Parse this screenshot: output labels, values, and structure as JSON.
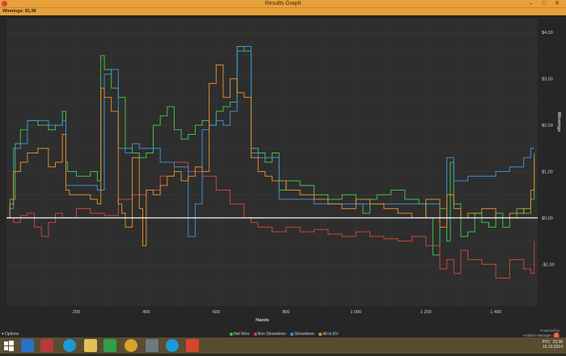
{
  "window": {
    "title": "Results Graph",
    "minimize": "–",
    "maximize": "□",
    "close": "✕",
    "app_icon": "holdem-manager-icon"
  },
  "winnings_label": "Winnings: $1,96",
  "footer": {
    "options_label": "Options",
    "legend": [
      {
        "label": "Net Won",
        "color": "#3fc24a"
      },
      {
        "label": "Non Showdown",
        "color": "#c9463a"
      },
      {
        "label": "Showdown",
        "color": "#3d8fd6"
      },
      {
        "label": "All-In EV",
        "color": "#e08a2c"
      }
    ],
    "powered_by": "Powered by",
    "brand": "HoldEm Manager",
    "brand_num": "2"
  },
  "taskbar": {
    "icons": [
      "windows-start-icon",
      "ie-icon",
      "save-icon",
      "skype-icon",
      "explorer-icon",
      "store-icon",
      "chrome-icon",
      "media-icon",
      "skype2-icon",
      "hm2-icon"
    ],
    "lang": "РУС",
    "time": "23:30",
    "date": "16.10.2014"
  },
  "chart_data": {
    "type": "line",
    "xlabel": "Hands",
    "ylabel": "Winnings",
    "x_ticks": [
      "200",
      "400",
      "600",
      "800",
      "1 000",
      "1 200",
      "1 400"
    ],
    "y_ticks": [
      "$4,00",
      "$3,00",
      "$2,00",
      "$1,00",
      "$0,00",
      "-$1,00"
    ],
    "xlim": [
      0,
      1520
    ],
    "ylim": [
      -1.9,
      4.3
    ],
    "grid": true,
    "series": [
      {
        "name": "Net Won",
        "color": "#3fc24a",
        "x": [
          0,
          10,
          25,
          40,
          60,
          90,
          120,
          140,
          160,
          170,
          175,
          200,
          240,
          260,
          270,
          280,
          300,
          320,
          340,
          360,
          380,
          400,
          420,
          440,
          460,
          480,
          500,
          520,
          540,
          560,
          580,
          600,
          620,
          640,
          660,
          680,
          700,
          720,
          740,
          760,
          780,
          800,
          840,
          880,
          920,
          960,
          1000,
          1020,
          1040,
          1060,
          1100,
          1140,
          1180,
          1200,
          1220,
          1240,
          1260,
          1270,
          1280,
          1300,
          1320,
          1340,
          1360,
          1380,
          1400,
          1420,
          1440,
          1460,
          1480,
          1500,
          1510
        ],
        "y": [
          0,
          0.4,
          1.6,
          1.9,
          2.1,
          2.0,
          1.9,
          2.0,
          2.3,
          1.2,
          1.0,
          0.9,
          1.0,
          0.8,
          3.5,
          3.2,
          2.8,
          2.6,
          1.5,
          1.4,
          1.3,
          1.4,
          2.0,
          2.2,
          2.4,
          1.9,
          1.7,
          1.8,
          2.0,
          2.1,
          2.0,
          2.3,
          2.4,
          2.5,
          3.7,
          3.6,
          1.5,
          1.4,
          1.2,
          1.4,
          0.6,
          0.8,
          0.7,
          0.5,
          0.4,
          0.5,
          0.3,
          0.1,
          0.4,
          0.5,
          0.6,
          0.4,
          0.3,
          0.0,
          -0.8,
          0.2,
          -0.5,
          1.2,
          0.3,
          -0.4,
          -0.3,
          0.1,
          -0.1,
          -0.2,
          0.1,
          -0.2,
          0.0,
          0.2,
          0.1,
          0.4,
          1.4
        ]
      },
      {
        "name": "Non Showdown",
        "color": "#c9463a",
        "x": [
          0,
          20,
          40,
          60,
          80,
          100,
          120,
          140,
          160,
          200,
          240,
          280,
          320,
          360,
          400,
          440,
          480,
          520,
          560,
          600,
          640,
          680,
          700,
          720,
          760,
          800,
          840,
          880,
          920,
          960,
          1000,
          1040,
          1080,
          1120,
          1160,
          1200,
          1240,
          1260,
          1280,
          1300,
          1320,
          1360,
          1400,
          1440,
          1480,
          1500,
          1510
        ],
        "y": [
          0,
          -0.1,
          0.05,
          0.1,
          -0.2,
          -0.4,
          -0.1,
          0.1,
          0.0,
          0.2,
          0.1,
          0.05,
          0.4,
          0.5,
          0.6,
          0.9,
          1.2,
          1.0,
          0.9,
          0.6,
          0.3,
          0.0,
          -0.1,
          -0.2,
          -0.3,
          -0.2,
          -0.3,
          -0.25,
          -0.35,
          -0.4,
          -0.3,
          -0.4,
          -0.45,
          -0.5,
          -0.4,
          -0.6,
          -1.1,
          -0.9,
          -1.2,
          -0.7,
          -0.9,
          -1.0,
          -1.3,
          -0.9,
          -1.1,
          -1.2,
          -0.5
        ]
      },
      {
        "name": "Showdown",
        "color": "#3d8fd6",
        "x": [
          0,
          10,
          20,
          40,
          60,
          80,
          100,
          120,
          140,
          160,
          170,
          180,
          200,
          240,
          260,
          280,
          300,
          320,
          340,
          360,
          380,
          400,
          440,
          480,
          500,
          520,
          540,
          560,
          580,
          600,
          620,
          640,
          660,
          680,
          700,
          720,
          740,
          760,
          780,
          800,
          840,
          880,
          920,
          960,
          1000,
          1040,
          1080,
          1120,
          1160,
          1200,
          1240,
          1260,
          1280,
          1300,
          1320,
          1360,
          1400,
          1440,
          1480,
          1500,
          1510
        ],
        "y": [
          0,
          0.2,
          1.5,
          1.6,
          2.1,
          2.1,
          2.1,
          2.0,
          2.0,
          2.1,
          0.7,
          0.7,
          0.7,
          0.7,
          0.6,
          3.1,
          3.2,
          1.5,
          1.4,
          1.6,
          1.5,
          1.5,
          1.2,
          1.1,
          1.1,
          -0.4,
          0.3,
          1.9,
          2.0,
          2.1,
          2.0,
          2.3,
          3.6,
          3.7,
          1.4,
          1.3,
          1.3,
          1.3,
          0.4,
          0.4,
          0.4,
          0.3,
          0.3,
          0.3,
          0.3,
          0.3,
          0.3,
          0.3,
          0.3,
          0.3,
          0.0,
          1.3,
          0.8,
          0.8,
          0.9,
          0.9,
          1.0,
          1.1,
          1.3,
          1.5,
          1.5
        ]
      },
      {
        "name": "All-In EV",
        "color": "#e08a2c",
        "x": [
          0,
          10,
          20,
          40,
          60,
          90,
          120,
          140,
          160,
          170,
          180,
          200,
          240,
          260,
          270,
          280,
          300,
          320,
          330,
          340,
          360,
          380,
          390,
          400,
          420,
          440,
          460,
          480,
          500,
          520,
          540,
          560,
          580,
          600,
          620,
          640,
          660,
          680,
          700,
          720,
          740,
          760,
          780,
          800,
          840,
          880,
          920,
          960,
          1000,
          1040,
          1080,
          1120,
          1160,
          1200,
          1240,
          1260,
          1280,
          1300,
          1320,
          1360,
          1400,
          1440,
          1480,
          1500,
          1510
        ],
        "y": [
          0,
          0.3,
          1.0,
          1.2,
          1.4,
          1.5,
          1.1,
          1.2,
          1.8,
          0.6,
          0.5,
          0.5,
          0.4,
          0.3,
          2.8,
          2.6,
          2.3,
          0.3,
          0.1,
          -0.2,
          1.3,
          0.2,
          -0.6,
          0.6,
          0.5,
          0.7,
          0.9,
          1.0,
          0.8,
          0.9,
          1.1,
          1.0,
          2.9,
          3.3,
          2.6,
          3.0,
          2.7,
          2.6,
          1.3,
          1.0,
          0.9,
          0.8,
          0.8,
          0.6,
          0.5,
          0.4,
          0.3,
          0.2,
          0.4,
          0.3,
          0.2,
          0.1,
          0.0,
          0.4,
          -0.2,
          0.5,
          0.2,
          0.0,
          0.1,
          0.2,
          0.0,
          0.1,
          0.2,
          0.6,
          1.3
        ]
      }
    ]
  }
}
